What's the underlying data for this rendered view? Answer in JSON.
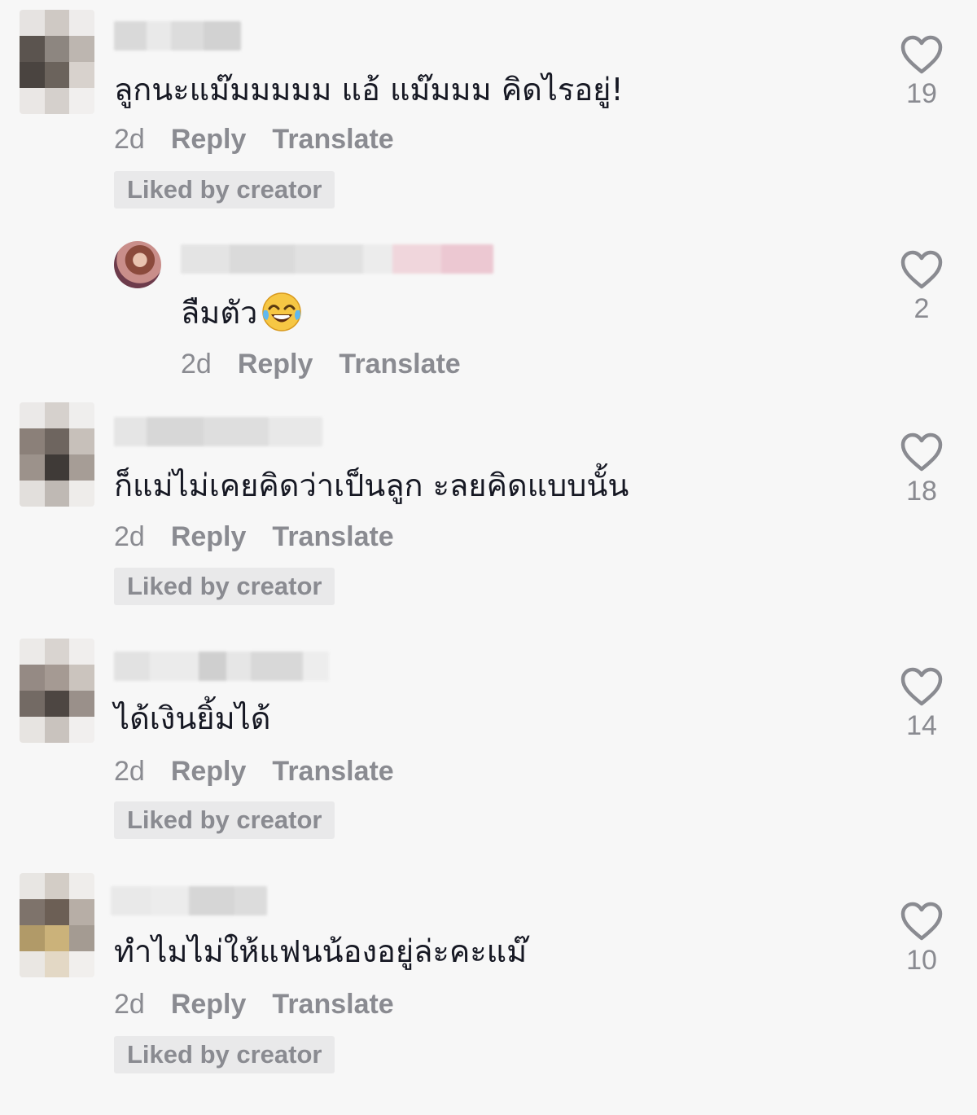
{
  "comments": [
    {
      "text": "ลูกนะแม๊มมมมม แอ้ แม๊มมม คิดไรอยู่!",
      "time": "2d",
      "reply": "Reply",
      "translate": "Translate",
      "badge": "Liked by creator",
      "likes": "19"
    },
    {
      "text": "ลืมตัว",
      "emoji": "face-with-tears-of-joy",
      "time": "2d",
      "reply": "Reply",
      "translate": "Translate",
      "likes": "2",
      "is_reply": true
    },
    {
      "text": "ก็แม่ไม่เคยคิดว่าเป็นลูก ะลยคิดแบบนั้น",
      "time": "2d",
      "reply": "Reply",
      "translate": "Translate",
      "badge": "Liked by creator",
      "likes": "18"
    },
    {
      "text": "ได้เงินยิ้มได้",
      "time": "2d",
      "reply": "Reply",
      "translate": "Translate",
      "badge": "Liked by creator",
      "likes": "14"
    },
    {
      "text": "ทำไมไม่ให้แฟนน้องอยู่ล่ะคะแม๊",
      "time": "2d",
      "reply": "Reply",
      "translate": "Translate",
      "badge": "Liked by creator",
      "likes": "10"
    }
  ],
  "icons": {
    "like": "heart-outline-icon"
  },
  "colors": {
    "background": "#f7f7f7",
    "text": "#161823",
    "meta": "#8a8b91",
    "badge_bg": "#e9e9ea"
  }
}
